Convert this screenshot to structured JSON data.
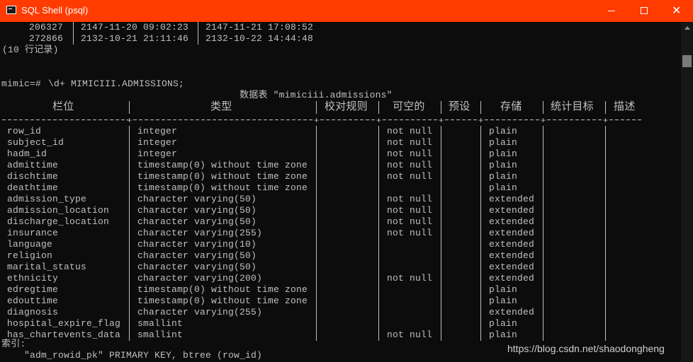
{
  "window": {
    "title": "SQL Shell (psql)",
    "accent_color": "#ff3b00",
    "controls": [
      "minimize-icon",
      "maximize-icon",
      "close-icon"
    ]
  },
  "prev_result": {
    "rows": [
      [
        "206327",
        "2147-11-20 09:02:23",
        "2147-11-21 17:08:52"
      ],
      [
        "272866",
        "2132-10-21 21:11:46",
        "2132-10-22 14:44:48"
      ]
    ],
    "row_count": "(10 行记录)"
  },
  "command": {
    "prompt": "mimic=#",
    "text": "\\d+ MIMICIII.ADMISSIONS;"
  },
  "table_title": "数据表 \"mimiciii.admissions\"",
  "headers": [
    "栏位",
    "类型",
    "校对规则",
    "可空的",
    "预设",
    "存储",
    "统计目标",
    "描述"
  ],
  "columns": [
    {
      "name": "row_id",
      "type": "integer",
      "nullable": "not null",
      "storage": "plain"
    },
    {
      "name": "subject_id",
      "type": "integer",
      "nullable": "not null",
      "storage": "plain"
    },
    {
      "name": "hadm_id",
      "type": "integer",
      "nullable": "not null",
      "storage": "plain"
    },
    {
      "name": "admittime",
      "type": "timestamp(0) without time zone",
      "nullable": "not null",
      "storage": "plain"
    },
    {
      "name": "dischtime",
      "type": "timestamp(0) without time zone",
      "nullable": "not null",
      "storage": "plain"
    },
    {
      "name": "deathtime",
      "type": "timestamp(0) without time zone",
      "nullable": "",
      "storage": "plain"
    },
    {
      "name": "admission_type",
      "type": "character varying(50)",
      "nullable": "not null",
      "storage": "extended"
    },
    {
      "name": "admission_location",
      "type": "character varying(50)",
      "nullable": "not null",
      "storage": "extended"
    },
    {
      "name": "discharge_location",
      "type": "character varying(50)",
      "nullable": "not null",
      "storage": "extended"
    },
    {
      "name": "insurance",
      "type": "character varying(255)",
      "nullable": "not null",
      "storage": "extended"
    },
    {
      "name": "language",
      "type": "character varying(10)",
      "nullable": "",
      "storage": "extended"
    },
    {
      "name": "religion",
      "type": "character varying(50)",
      "nullable": "",
      "storage": "extended"
    },
    {
      "name": "marital_status",
      "type": "character varying(50)",
      "nullable": "",
      "storage": "extended"
    },
    {
      "name": "ethnicity",
      "type": "character varying(200)",
      "nullable": "not null",
      "storage": "extended"
    },
    {
      "name": "edregtime",
      "type": "timestamp(0) without time zone",
      "nullable": "",
      "storage": "plain"
    },
    {
      "name": "edouttime",
      "type": "timestamp(0) without time zone",
      "nullable": "",
      "storage": "plain"
    },
    {
      "name": "diagnosis",
      "type": "character varying(255)",
      "nullable": "",
      "storage": "extended"
    },
    {
      "name": "hospital_expire_flag",
      "type": "smallint",
      "nullable": "",
      "storage": "plain"
    },
    {
      "name": "has_chartevents_data",
      "type": "smallint",
      "nullable": "not null",
      "storage": "plain"
    }
  ],
  "indexes_label": "索引:",
  "index_line": "\"adm_rowid_pk\" PRIMARY KEY, btree (row_id)",
  "watermark": "https://blog.csdn.net/shaodongheng"
}
